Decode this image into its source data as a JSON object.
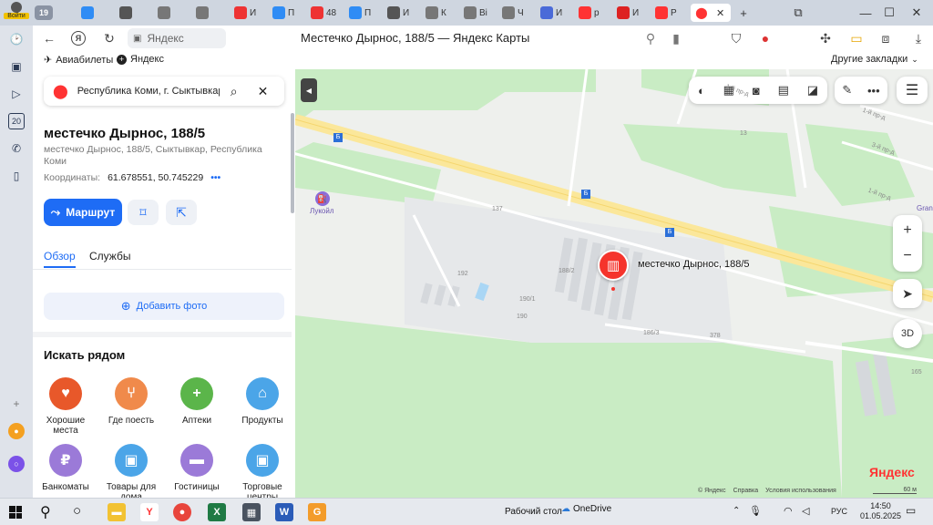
{
  "browser": {
    "account_label": "Войти",
    "tab_counter": "19",
    "page_title": "Местечко Дырнос, 188/5 — Яндекс Карты",
    "url_text": "Яндекс",
    "tabs": [
      {
        "label": "",
        "icon": "maps-icon",
        "color": "#2f8cf5"
      },
      {
        "label": "",
        "icon": "doc-icon",
        "color": "#555"
      },
      {
        "label": "",
        "icon": "table-icon",
        "color": "#777"
      },
      {
        "label": "",
        "icon": "table-icon",
        "color": "#777"
      },
      {
        "label": "И",
        "icon": "pdf-icon",
        "color": "#e33"
      },
      {
        "label": "П",
        "icon": "mail-icon",
        "color": "#2f8cf5"
      },
      {
        "label": "48",
        "icon": "pdf-icon",
        "color": "#e33"
      },
      {
        "label": "П",
        "icon": "mail-icon",
        "color": "#2f8cf5"
      },
      {
        "label": "И",
        "icon": "doc-icon",
        "color": "#555"
      },
      {
        "label": "К",
        "icon": "table-icon",
        "color": "#777"
      },
      {
        "label": "Ві",
        "icon": "table-icon",
        "color": "#777"
      },
      {
        "label": "Ч",
        "icon": "table-icon",
        "color": "#777"
      },
      {
        "label": "И",
        "icon": "shield-icon",
        "color": "#4a6ad8"
      },
      {
        "label": "р",
        "icon": "yandex-icon",
        "color": "#f33"
      },
      {
        "label": "И",
        "icon": "rts-icon",
        "color": "#d22"
      },
      {
        "label": "Р",
        "icon": "yandex-icon",
        "color": "#f33"
      }
    ]
  },
  "bookmarks": {
    "items": [
      {
        "label": "Авиабилеты",
        "icon": "plane-icon"
      },
      {
        "label": "Яндекс",
        "icon": "plus-circle-icon"
      }
    ],
    "other_label": "Другие закладки"
  },
  "panel": {
    "search_value": "Республика Коми, г. Сыктывкар",
    "place_title": "местечко Дырнос, 188/5",
    "address": "местечко Дырнос, 188/5, Сыктывкар, Республика Коми",
    "coords_label": "Координаты:",
    "coords_value": "61.678551, 50.745229",
    "route_label": "Маршрут",
    "tabs": [
      {
        "label": "Обзор",
        "active": true
      },
      {
        "label": "Службы",
        "active": false
      }
    ],
    "add_photo_label": "Добавить фото",
    "nearby_title": "Искать рядом",
    "categories": [
      {
        "label": "Хорошие места",
        "icon": "good-places-icon",
        "color": "#e8582a"
      },
      {
        "label": "Где поесть",
        "icon": "food-icon",
        "color": "#f08a4b"
      },
      {
        "label": "Аптеки",
        "icon": "pharmacy-icon",
        "color": "#5bb54a"
      },
      {
        "label": "Продукты",
        "icon": "basket-icon",
        "color": "#4ba5e8"
      },
      {
        "label": "Банкоматы",
        "icon": "ruble-icon",
        "color": "#9b7ad8"
      },
      {
        "label": "Товары для дома",
        "icon": "bag-icon",
        "color": "#4ba5e8"
      },
      {
        "label": "Гостиницы",
        "icon": "bed-icon",
        "color": "#9b7ad8"
      },
      {
        "label": "Торговые центры",
        "icon": "bag-icon",
        "color": "#4ba5e8"
      }
    ]
  },
  "map": {
    "marker_label": "местечко Дырнос, 188/5",
    "poi_label": "Лукойл",
    "poi_right": "Gran",
    "building_labels": [
      "137",
      "188/2",
      "192",
      "190/1",
      "190",
      "186/3",
      "378",
      "165",
      "13"
    ],
    "street_labels": [
      "1-й пр-д",
      "1-й пр-д",
      "3-й пр-д",
      "1-й пр-д"
    ],
    "three_d_label": "3D",
    "scale_label": "60 м",
    "brand": "Яндекс",
    "attribution": [
      "© Яндекс",
      "Справка",
      "Условия использования"
    ]
  },
  "taskbar": {
    "desktop_label": "Рабочий стол",
    "onedrive_label": "OneDrive",
    "lang": "РУС",
    "time": "14:50",
    "date": "01.05.2025"
  }
}
